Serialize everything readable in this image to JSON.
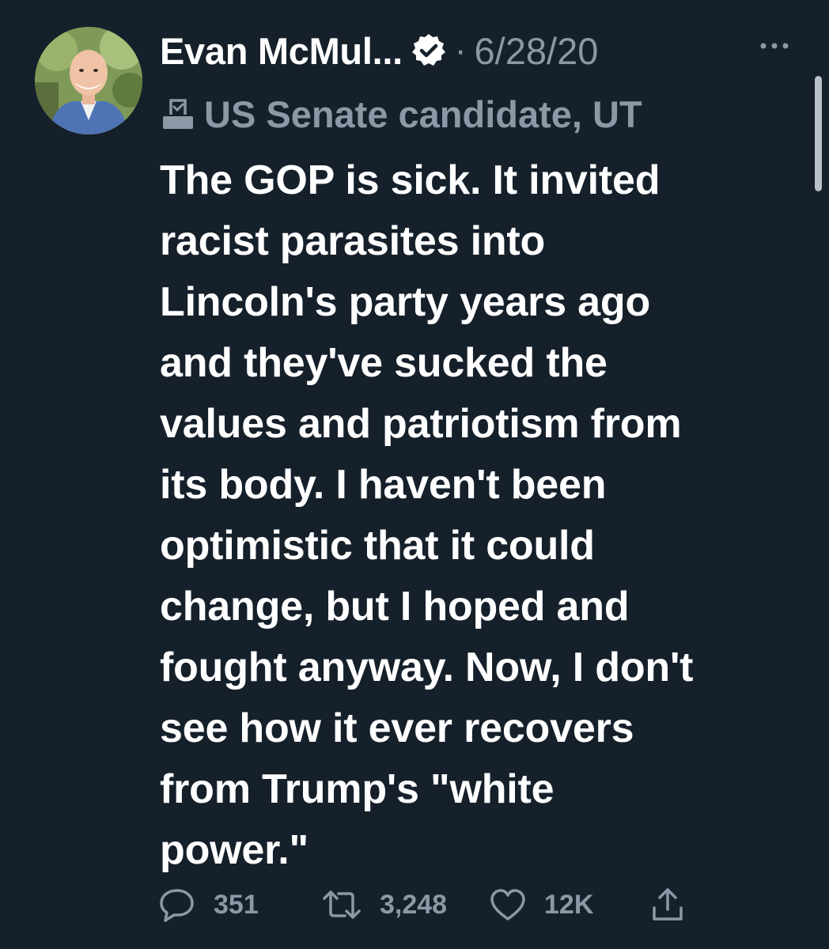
{
  "tweet": {
    "author": {
      "display_name": "Evan McMul...",
      "verified": true,
      "avatar_icon": "profile-photo"
    },
    "separator": "·",
    "date": "6/28/20",
    "more_icon": "more-dots-icon",
    "label": {
      "icon": "ballot-box-icon",
      "text": "US Senate candidate, UT"
    },
    "text_lines": [
      "The GOP is sick. It invited",
      "racist parasites into",
      "Lincoln's party years ago",
      "and they've sucked the",
      "values and patriotism from",
      "its body. I haven't been",
      "optimistic that it could",
      "change, but I hoped and",
      "fought anyway. Now, I don't",
      "see how it ever recovers",
      "from Trump's \"white",
      "power.\""
    ],
    "actions": {
      "reply_count": "351",
      "retweet_count": "3,248",
      "like_count": "12K"
    }
  },
  "colors": {
    "background": "#15202b",
    "text_primary": "#ffffff",
    "text_secondary": "#8b98a5"
  }
}
